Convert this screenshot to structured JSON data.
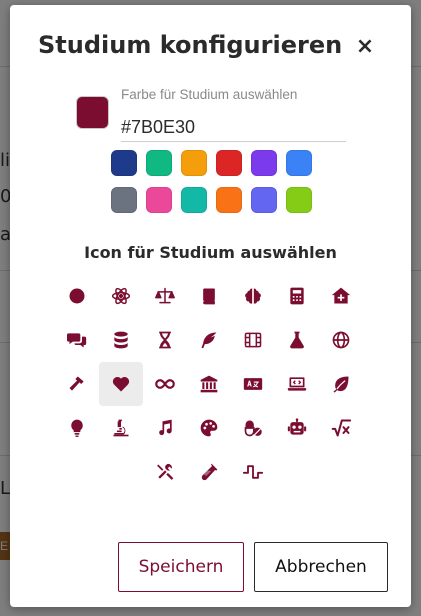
{
  "modal": {
    "title": "Studium konfigurieren",
    "close_label": "×",
    "accent_color": "#7B0E30"
  },
  "color": {
    "label": "Farbe für Studium auswählen",
    "value": "#7B0E30",
    "palette": [
      "#1e3a8a",
      "#10b981",
      "#f59e0b",
      "#dc2626",
      "#7c3aed",
      "#3b82f6",
      "#6b7280",
      "#ec4899",
      "#14b8a6",
      "#f97316",
      "#6366f1",
      "#84cc16"
    ]
  },
  "icons": {
    "heading": "Icon für Studium auswählen",
    "selected": "heart-icon",
    "items": [
      "circle-icon",
      "atom-icon",
      "scale-icon",
      "book-icon",
      "brain-icon",
      "calculator-icon",
      "house-medical-icon",
      "comments-icon",
      "database-icon",
      "hourglass-icon",
      "feather-icon",
      "film-icon",
      "flask-icon",
      "globe-icon",
      "hammer-icon",
      "heart-icon",
      "infinity-icon",
      "landmark-icon",
      "language-icon",
      "laptop-code-icon",
      "leaf-icon",
      "lightbulb-icon",
      "microscope-icon",
      "music-icon",
      "palette-icon",
      "pills-icon",
      "robot-icon",
      "square-root-icon",
      "tools-icon",
      "vial-icon",
      "wave-square-icon"
    ]
  },
  "buttons": {
    "save": "Speichern",
    "cancel": "Abbrechen"
  },
  "background": {
    "fragments": [
      "li",
      "0",
      "a",
      "L",
      "E"
    ]
  }
}
